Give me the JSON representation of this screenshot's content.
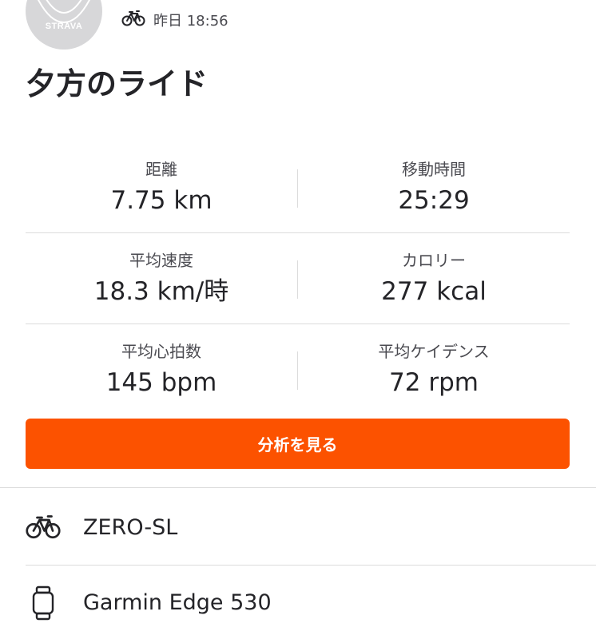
{
  "header": {
    "avatar_text": "STRAVA",
    "activity_icon": "bike-icon",
    "timestamp": "昨日 18:56"
  },
  "activity": {
    "title": "夕方のライド"
  },
  "stats": [
    {
      "label": "距離",
      "value": "7.75 km"
    },
    {
      "label": "移動時間",
      "value": "25:29"
    },
    {
      "label": "平均速度",
      "value": "18.3 km/時"
    },
    {
      "label": "カロリー",
      "value": "277 kcal"
    },
    {
      "label": "平均心拍数",
      "value": "145 bpm"
    },
    {
      "label": "平均ケイデンス",
      "value": "72 rpm"
    }
  ],
  "actions": {
    "analysis_label": "分析を見る"
  },
  "gear": [
    {
      "icon": "bike-icon",
      "label": "ZERO-SL"
    },
    {
      "icon": "watch-device-icon",
      "label": "Garmin Edge 530"
    }
  ],
  "colors": {
    "accent": "#fc5200",
    "text": "#242428",
    "muted": "#4a4a50",
    "divider": "#dcdcdc"
  }
}
